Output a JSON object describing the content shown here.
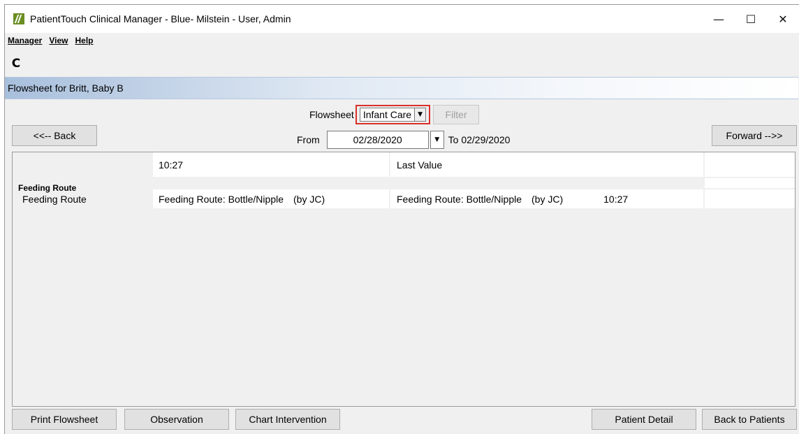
{
  "window": {
    "title": "PatientTouch Clinical Manager - Blue- Milstein - User, Admin",
    "controls": {
      "minimize": "—",
      "maximize": "☐",
      "close": "✕"
    }
  },
  "menu": {
    "manager": "Manager",
    "view": "View",
    "help": "Help"
  },
  "toolbar": {
    "refresh_icon": "↻",
    "refresh_glyph": "C"
  },
  "header": {
    "title": "Flowsheet for Britt, Baby B"
  },
  "flowsheet": {
    "label": "Flowsheet",
    "selected": "Infant Care",
    "filter_label": "Filter"
  },
  "nav": {
    "back_label": "<<-- Back",
    "forward_label": "Forward -->>"
  },
  "dates": {
    "from_label": "From",
    "from_value": "02/28/2020",
    "to_text": "To 02/29/2020"
  },
  "grid": {
    "columns": {
      "time": "10:27",
      "last_value": "Last Value"
    },
    "group": "Feeding Route",
    "rows": [
      {
        "label": "Feeding Route",
        "value": "Feeding Route: Bottle/Nipple",
        "by": "(by JC)",
        "last_value": "Feeding Route: Bottle/Nipple",
        "last_by": "(by JC)",
        "last_time": "10:27"
      }
    ]
  },
  "footer": {
    "print": "Print Flowsheet",
    "observation": "Observation",
    "chart_intervention": "Chart Intervention",
    "patient_detail": "Patient Detail",
    "back_to_patients": "Back to Patients"
  },
  "colors": {
    "highlight": "#d9302a",
    "header_band_start": "#a8bfdc",
    "window_bg": "#f0f0f0"
  }
}
